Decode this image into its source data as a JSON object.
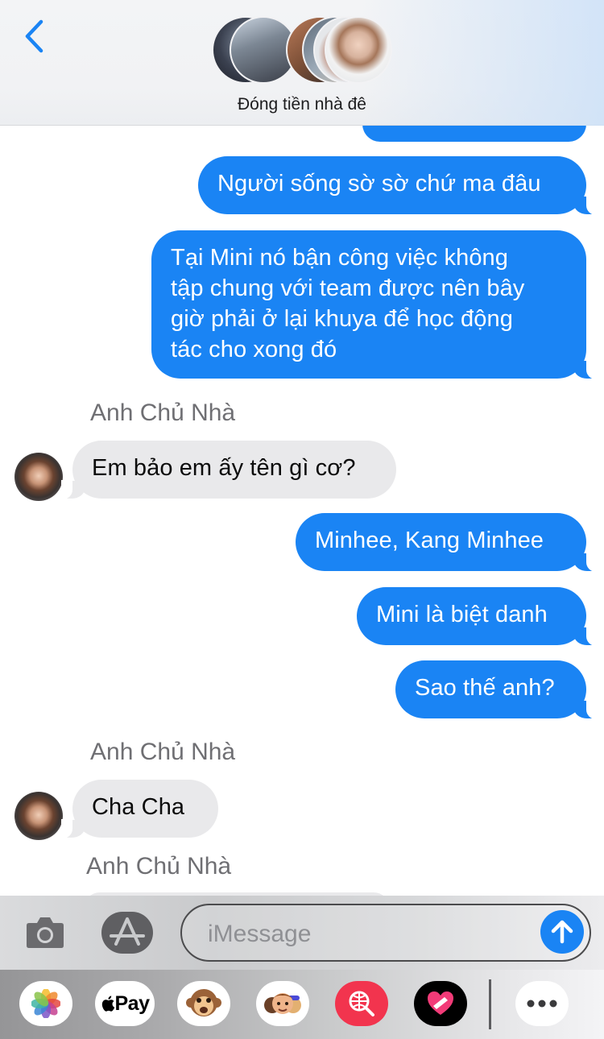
{
  "header": {
    "group_name": "Đóng tiền nhà đê"
  },
  "messages": [
    {
      "direction": "out",
      "text": "Người sống sờ sờ chứ ma đâu"
    },
    {
      "direction": "out",
      "text": "Tại Mini nó bận công việc không\ntập chung với team được nên bây\ngiờ phải ở lại khuya để học động\ntác cho xong đó"
    },
    {
      "direction": "in",
      "sender": "Anh Chủ Nhà",
      "text": "Em bảo em ấy tên gì cơ?"
    },
    {
      "direction": "out",
      "text": "Minhee, Kang Minhee"
    },
    {
      "direction": "out",
      "text": "Mini là biệt danh"
    },
    {
      "direction": "out",
      "text": "Sao thế anh?"
    },
    {
      "direction": "in",
      "sender": "Anh Chủ Nhà",
      "text": "Cha Cha"
    },
    {
      "direction": "in",
      "sender": "Anh Chủ Nhà",
      "text": ""
    }
  ],
  "input": {
    "placeholder": "iMessage"
  },
  "drawer": {
    "apple_pay_label": "Pay",
    "items": [
      "photos-app",
      "apple-pay-app",
      "animoji-app",
      "memoji-app",
      "search-images-app",
      "digital-touch-app",
      "more-apps"
    ]
  },
  "colors": {
    "outgoing_bubble": "#1a84f4",
    "incoming_bubble": "#e9e9eb",
    "accent": "#1a84f4"
  }
}
